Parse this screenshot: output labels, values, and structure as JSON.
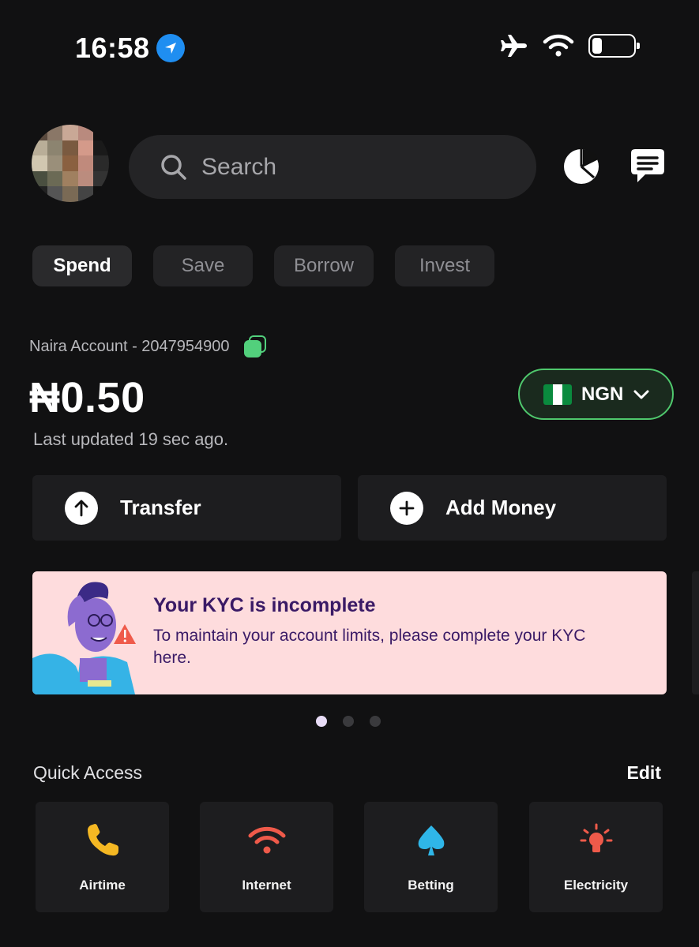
{
  "status_bar": {
    "time": "16:58",
    "icons": [
      "location-arrow-icon",
      "airplane-icon",
      "wifi-icon",
      "battery-icon"
    ]
  },
  "header": {
    "search_placeholder": "Search",
    "icons": [
      "avatar",
      "search-icon",
      "pie-chart-icon",
      "chat-icon"
    ]
  },
  "tabs": [
    {
      "label": "Spend",
      "active": true
    },
    {
      "label": "Save",
      "active": false
    },
    {
      "label": "Borrow",
      "active": false
    },
    {
      "label": "Invest",
      "active": false
    }
  ],
  "account": {
    "label": "Naira Account - 2047954900",
    "balance": "₦0.50",
    "last_updated": "Last updated 19 sec ago.",
    "currency": "NGN"
  },
  "actions": {
    "transfer": "Transfer",
    "add_money": "Add Money"
  },
  "banner": {
    "title": "Your KYC is incomplete",
    "body": "To maintain your account limits, please complete your KYC here."
  },
  "carousel": {
    "pages": 3,
    "active": 1
  },
  "quick_access": {
    "title": "Quick Access",
    "edit": "Edit",
    "items": [
      {
        "label": "Airtime",
        "icon": "phone-icon"
      },
      {
        "label": "Internet",
        "icon": "wifi-icon"
      },
      {
        "label": "Betting",
        "icon": "spade-icon"
      },
      {
        "label": "Electricity",
        "icon": "bulb-icon"
      }
    ]
  },
  "colors": {
    "background": "#111112",
    "card": "#1d1d1f",
    "accent_green": "#4fc86d",
    "banner_bg": "#fedcdd",
    "banner_text": "#3a1a66",
    "airtime": "#f5b823",
    "internet": "#ef5a4a",
    "betting": "#2fb6e8",
    "electricity": "#ef5a4a"
  }
}
